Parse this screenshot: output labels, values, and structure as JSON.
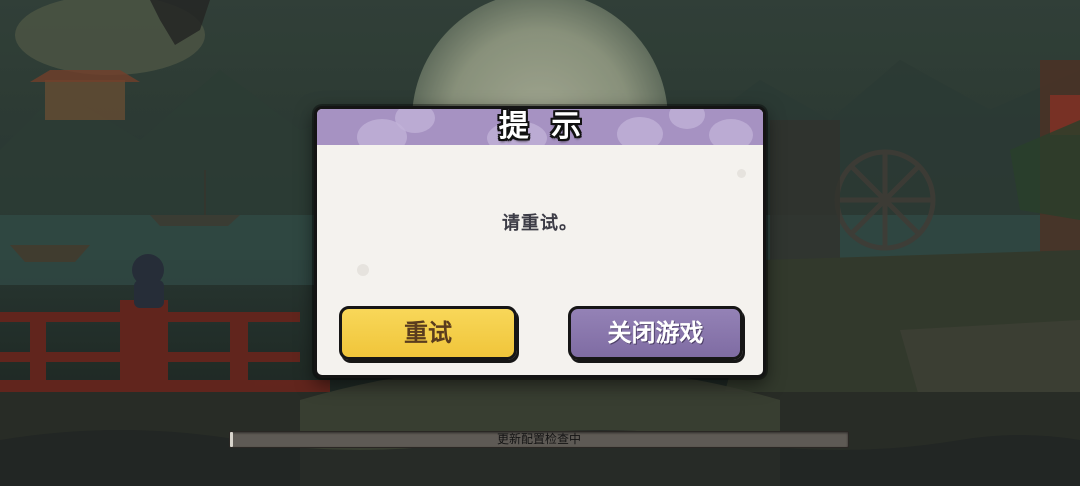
{
  "dialog": {
    "title": "提 示",
    "message": "请重试。",
    "retry_label": "重试",
    "close_label": "关闭游戏"
  },
  "loading": {
    "status_text": "更新配置检查中",
    "progress": 0.005
  },
  "colors": {
    "header_purple": "#a692c2",
    "retry_yellow": "#f4cd48",
    "close_purple": "#8a77ad",
    "panel_bg": "#f4f2ee"
  }
}
